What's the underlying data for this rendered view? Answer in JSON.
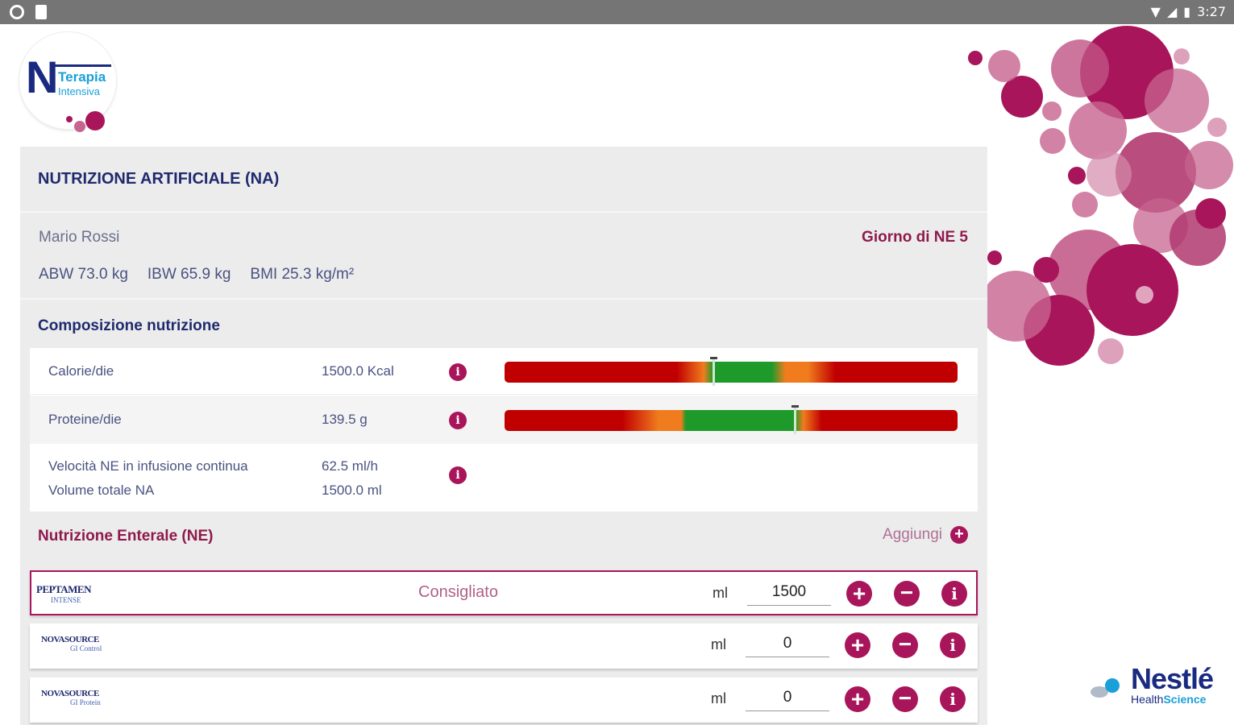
{
  "status_bar": {
    "time": "3:27"
  },
  "logo": {
    "letter": "N",
    "line1": "Terapia",
    "line2": "Intensiva"
  },
  "panel": {
    "title": "NUTRIZIONE ARTIFICIALE (NA)",
    "patient": {
      "name": "Mario Rossi",
      "day": "Giorno di NE 5",
      "abw": "ABW 73.0 kg",
      "ibw": "IBW 65.9 kg",
      "bmi": "BMI 25.3 kg/m²"
    },
    "composition": {
      "title": "Composizione nutrizione",
      "rows": [
        {
          "label": "Calorie/die",
          "value": "1500.0 Kcal",
          "gauge_marker_fraction": 0.46
        },
        {
          "label": "Proteine/die",
          "value": "139.5 g",
          "gauge_marker_fraction": 0.64
        },
        {
          "label": "Velocità NE in infusione continua",
          "value": "62.5 ml/h"
        },
        {
          "label": "Volume totale NA",
          "value": "1500.0 ml"
        }
      ]
    },
    "enteral": {
      "title": "Nutrizione Enterale (NE)",
      "add_label": "Aggiungi",
      "products": [
        {
          "logo_line1": "PEPTAMEN",
          "logo_line2": "INTENSE",
          "badge": "Consigliato",
          "unit": "ml",
          "quantity": "1500"
        },
        {
          "logo_line1": "NOVASOURCE",
          "logo_line2": "GI Control",
          "badge": "",
          "unit": "ml",
          "quantity": "0"
        },
        {
          "logo_line1": "NOVASOURCE",
          "logo_line2": "GI Protein",
          "badge": "",
          "unit": "ml",
          "quantity": "0"
        }
      ]
    }
  },
  "brand": {
    "name": "Nestlé",
    "sub_a": "Health",
    "sub_b": "Science"
  },
  "colors": {
    "accent": "#a8155a",
    "title_navy": "#1f2a6e",
    "gauge_red": "#c00000",
    "gauge_orange": "#f07c1e",
    "gauge_green": "#1e9a2a"
  }
}
